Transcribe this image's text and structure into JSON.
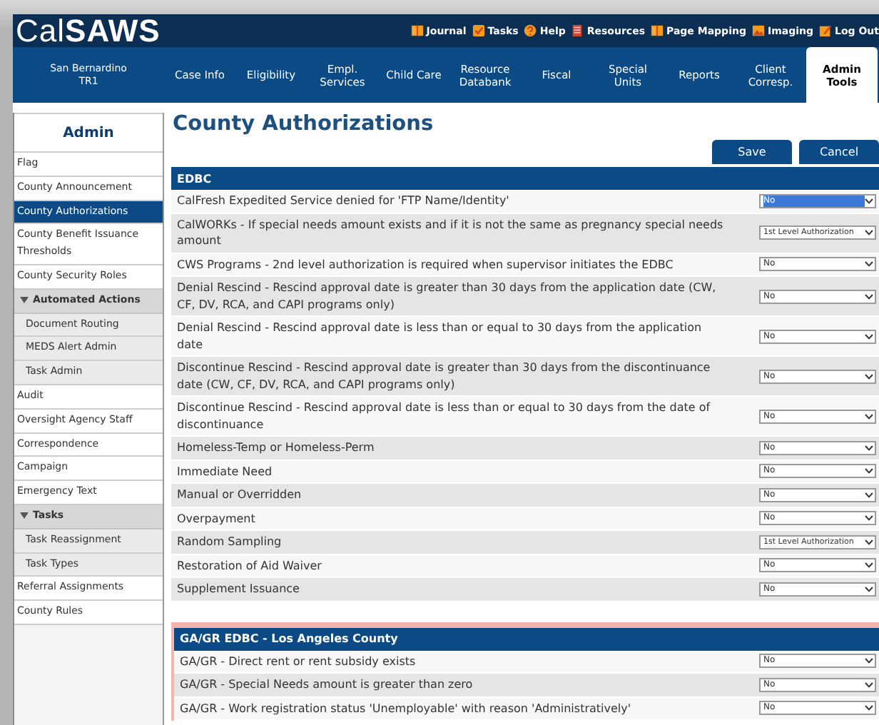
{
  "header": {
    "logo_regular": "Cal",
    "logo_bold": "SAWS",
    "links": [
      {
        "kind": "journal",
        "label": "Journal"
      },
      {
        "kind": "tasks",
        "label": "Tasks"
      },
      {
        "kind": "help",
        "label": "Help"
      },
      {
        "kind": "resources",
        "label": "Resources"
      },
      {
        "kind": "mapping",
        "label": "Page Mapping"
      },
      {
        "kind": "imaging",
        "label": "Imaging"
      },
      {
        "kind": "logout",
        "label": "Log Out"
      }
    ]
  },
  "office": {
    "name": "San Bernardino",
    "unit": "TR1"
  },
  "tabs": [
    {
      "label": "Case Info",
      "selected": false
    },
    {
      "label": "Eligibility",
      "selected": false
    },
    {
      "label": "Empl.\nServices",
      "selected": false
    },
    {
      "label": "Child Care",
      "selected": false
    },
    {
      "label": "Resource\nDatabank",
      "selected": false
    },
    {
      "label": "Fiscal",
      "selected": false
    },
    {
      "label": "Special\nUnits",
      "selected": false
    },
    {
      "label": "Reports",
      "selected": false
    },
    {
      "label": "Client\nCorresp.",
      "selected": false
    },
    {
      "label": "Admin\nTools",
      "selected": true
    }
  ],
  "sidebar": {
    "title": "Admin",
    "items": [
      {
        "label": "Flag",
        "selected": false
      },
      {
        "label": "County Announcement",
        "selected": false
      },
      {
        "label": "County Authorizations",
        "selected": true
      },
      {
        "label": "County Benefit Issuance Thresholds",
        "selected": false
      },
      {
        "label": "County Security Roles",
        "selected": false
      },
      {
        "label": "Automated Actions",
        "expanded": true,
        "children": [
          {
            "label": "Document Routing",
            "selected": false
          },
          {
            "label": "MEDS Alert Admin",
            "selected": false
          },
          {
            "label": "Task Admin",
            "selected": false
          }
        ]
      },
      {
        "label": "Audit",
        "selected": false
      },
      {
        "label": "Oversight Agency Staff",
        "selected": false
      },
      {
        "label": "Correspondence",
        "selected": false
      },
      {
        "label": "Campaign",
        "selected": false
      },
      {
        "label": "Emergency Text",
        "selected": false
      },
      {
        "label": "Tasks",
        "expanded": true,
        "children": [
          {
            "label": "Task Reassignment",
            "selected": false
          },
          {
            "label": "Task Types",
            "selected": false
          }
        ]
      },
      {
        "label": "Referral Assignments",
        "selected": false
      },
      {
        "label": "County Rules",
        "selected": false
      }
    ]
  },
  "page_title": "County Authorizations",
  "buttons": [
    "Save",
    "Cancel"
  ],
  "sections": [
    {
      "title": "EDBC",
      "highlighted": false,
      "rows": [
        {
          "label": "CalFresh Expedited Service denied for 'FTP Name/Identity'",
          "value": "No",
          "focused": true
        },
        {
          "label": "CalWORKs - If special needs amount exists and if it is not the same as pregnancy special needs amount",
          "value": "1st Level Authorization",
          "focused": false
        },
        {
          "label": "CWS Programs - 2nd level authorization is required when supervisor initiates the EDBC",
          "value": "No",
          "focused": false
        },
        {
          "label": "Denial Rescind - Rescind approval date is greater than 30 days from the application date (CW, CF, DV, RCA, and CAPI programs only)",
          "value": "No",
          "focused": false
        },
        {
          "label": "Denial Rescind - Rescind approval date is less than or equal to 30 days from the application date",
          "value": "No",
          "focused": false
        },
        {
          "label": "Discontinue Rescind - Rescind approval date is greater than 30 days from the discontinuance date (CW, CF, DV, RCA, and CAPI programs only)",
          "value": "No",
          "focused": false
        },
        {
          "label": "Discontinue Rescind - Rescind approval date is less than or equal to 30 days from the date of discontinuance",
          "value": "No",
          "focused": false
        },
        {
          "label": "Homeless-Temp or Homeless-Perm",
          "value": "No",
          "focused": false
        },
        {
          "label": "Immediate Need",
          "value": "No",
          "focused": false
        },
        {
          "label": "Manual or Overridden",
          "value": "No",
          "focused": false
        },
        {
          "label": "Overpayment",
          "value": "No",
          "focused": false
        },
        {
          "label": "Random Sampling",
          "value": "1st Level Authorization",
          "focused": false
        },
        {
          "label": "Restoration of Aid Waiver",
          "value": "No",
          "focused": false
        },
        {
          "label": "Supplement Issuance",
          "value": "No",
          "focused": false
        }
      ]
    },
    {
      "title": "GA/GR EDBC - Los Angeles County",
      "highlighted": true,
      "rows": [
        {
          "label": "GA/GR - Direct rent or rent subsidy exists",
          "value": "No",
          "focused": false
        },
        {
          "label": "GA/GR - Special Needs amount is greater than zero",
          "value": "No",
          "focused": false
        },
        {
          "label": "GA/GR - Work registration status 'Unemployable' with reason 'Administratively'",
          "value": "No",
          "focused": false
        }
      ]
    }
  ]
}
